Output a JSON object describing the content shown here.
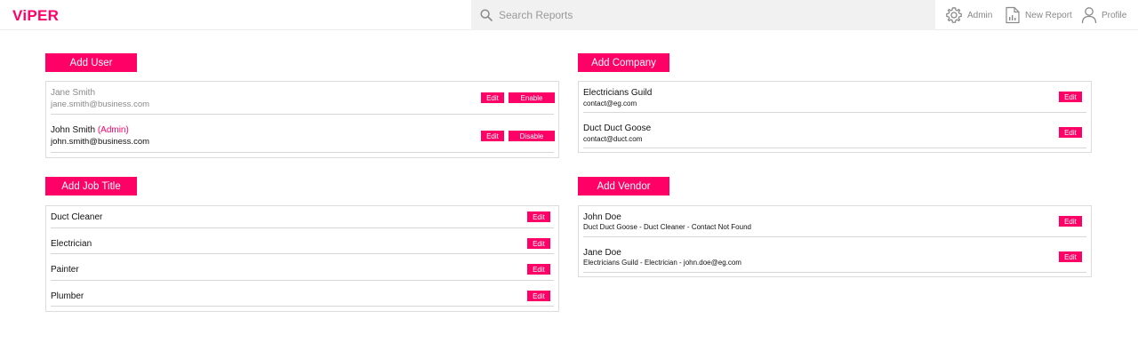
{
  "app": {
    "logo": "ViPER"
  },
  "search": {
    "placeholder": "Search Reports"
  },
  "nav": {
    "admin": "Admin",
    "new_report": "New Report",
    "profile": "Profile"
  },
  "users": {
    "add_label": "Add User",
    "items": [
      {
        "name": "Jane Smith",
        "tag": "",
        "email": "jane.smith@business.com",
        "edit": "Edit",
        "toggle": "Enable"
      },
      {
        "name": "John Smith",
        "tag": "(Admin)",
        "email": "john.smith@business.com",
        "edit": "Edit",
        "toggle": "Disable"
      }
    ]
  },
  "companies": {
    "add_label": "Add Company",
    "items": [
      {
        "name": "Electricians Guild",
        "contact": "contact@eg.com",
        "edit": "Edit"
      },
      {
        "name": "Duct Duct Goose",
        "contact": "contact@duct.com",
        "edit": "Edit"
      }
    ]
  },
  "job_titles": {
    "add_label": "Add Job Title",
    "items": [
      {
        "name": "Duct Cleaner",
        "edit": "Edit"
      },
      {
        "name": "Electrician",
        "edit": "Edit"
      },
      {
        "name": "Painter",
        "edit": "Edit"
      },
      {
        "name": "Plumber",
        "edit": "Edit"
      }
    ]
  },
  "vendors": {
    "add_label": "Add Vendor",
    "items": [
      {
        "name": "John Doe",
        "detail": "Duct Duct Goose - Duct Cleaner - Contact Not Found",
        "edit": "Edit"
      },
      {
        "name": "Jane Doe",
        "detail": "Electricians Guild - Electrician - john.doe@eg.com",
        "edit": "Edit"
      }
    ]
  },
  "colors": {
    "accent": "#ff0066",
    "muted_text": "#8a8a8a",
    "border": "#dcdcdc"
  },
  "icons": {
    "search": "search-icon",
    "admin": "gear-icon",
    "new_report": "report-icon",
    "profile": "user-icon"
  }
}
